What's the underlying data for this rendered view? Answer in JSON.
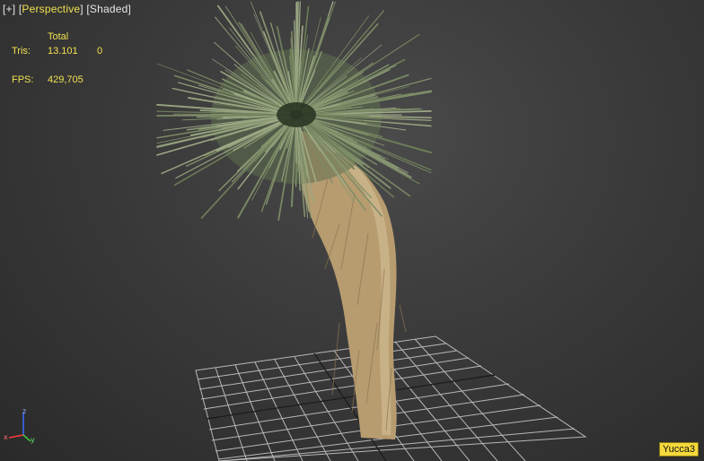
{
  "viewport_menu": {
    "plus": "[+]",
    "view": "Perspective",
    "shading": "Shaded"
  },
  "stats": {
    "header_total": "Total",
    "tris_label": "Tris:",
    "tris_total": "13.101",
    "tris_selected": "0",
    "fps_label": "FPS:",
    "fps_value": "429,705"
  },
  "axis": {
    "z": "z",
    "x": "x",
    "y": "y"
  },
  "object_name": "Yucca3",
  "colors": {
    "ui_text": "#e6e6e6",
    "stats_yellow": "#f1e050",
    "badge_bg": "#f6d93c",
    "foliage": "#7e8f68",
    "trunk": "#c8ad80",
    "grid": "#c8c8c8"
  }
}
